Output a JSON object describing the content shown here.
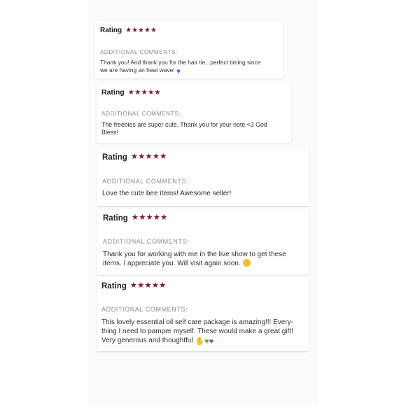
{
  "reviews": [
    {
      "rating_label": "Rating",
      "stars": 5,
      "comment_heading": "ADDITIONAL COMMENTS:",
      "comment_line1": "Thank you! And thank you for the hair tie...perfect timing since",
      "comment_line2": "we are having an heat wave!",
      "emoji": "purple-heart"
    },
    {
      "rating_label": "Rating",
      "stars": 5,
      "comment_heading": "ADDITIONAL COMMENTS:",
      "comment_line1": "The freebies are super cute. Thank you for your note <3 God",
      "comment_line2": "Bless!"
    },
    {
      "rating_label": "Rating",
      "stars": 5,
      "comment_heading": "ADDITIONAL COMMENTS:",
      "comment_line1": "Love the cute bee items! Awesome seller!"
    },
    {
      "rating_label": "Rating",
      "stars": 5,
      "comment_heading": "ADDITIONAL COMMENTS:",
      "comment_line1": "Thank you for working with me in the live show to get these",
      "comment_line2": "items. I appreciate you. Will visit again soon.",
      "emoji": "smirking-face"
    },
    {
      "rating_label": "Rating",
      "stars": 5,
      "comment_heading": "ADDITIONAL COMMENTS:",
      "comment_line1": "This lovely essential oil self care package is amazing!!! Every-",
      "comment_line2": "thing I need to pamper myself. These would make a great gift!",
      "comment_line3": "Very generous and thoughtful",
      "emoji": "praying-hands, green-heart, purple-heart"
    }
  ],
  "colors": {
    "star": "#7a1e2e",
    "heading": "#8a8a8a",
    "text": "#2f2f2f"
  }
}
